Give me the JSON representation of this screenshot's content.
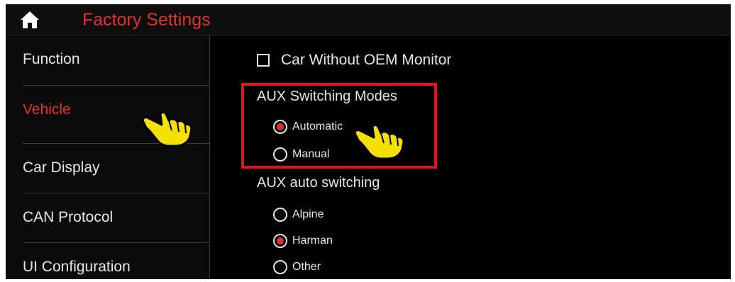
{
  "header": {
    "title": "Factory Settings",
    "home_icon": "home-icon"
  },
  "sidebar": {
    "items": [
      {
        "label": "Function"
      },
      {
        "label": "Vehicle",
        "active": true
      },
      {
        "label": "Car Display"
      },
      {
        "label": "CAN Protocol"
      },
      {
        "label": "UI Configuration"
      }
    ]
  },
  "main": {
    "car_without_oem_monitor": {
      "label": "Car Without OEM Monitor",
      "checked": false
    },
    "aux_switching_modes": {
      "title": "AUX Switching Modes",
      "options": [
        {
          "label": "Automatic",
          "selected": true
        },
        {
          "label": "Manual",
          "selected": false
        }
      ]
    },
    "aux_auto_switching": {
      "title": "AUX auto switching",
      "options": [
        {
          "label": "Alpine",
          "selected": false
        },
        {
          "label": "Harman",
          "selected": true
        },
        {
          "label": "Other",
          "selected": false
        }
      ]
    }
  },
  "colors": {
    "accent": "#e0322c",
    "highlight_border": "#e3141c",
    "pointer_hand": "#f5e000",
    "background": "#000000"
  }
}
